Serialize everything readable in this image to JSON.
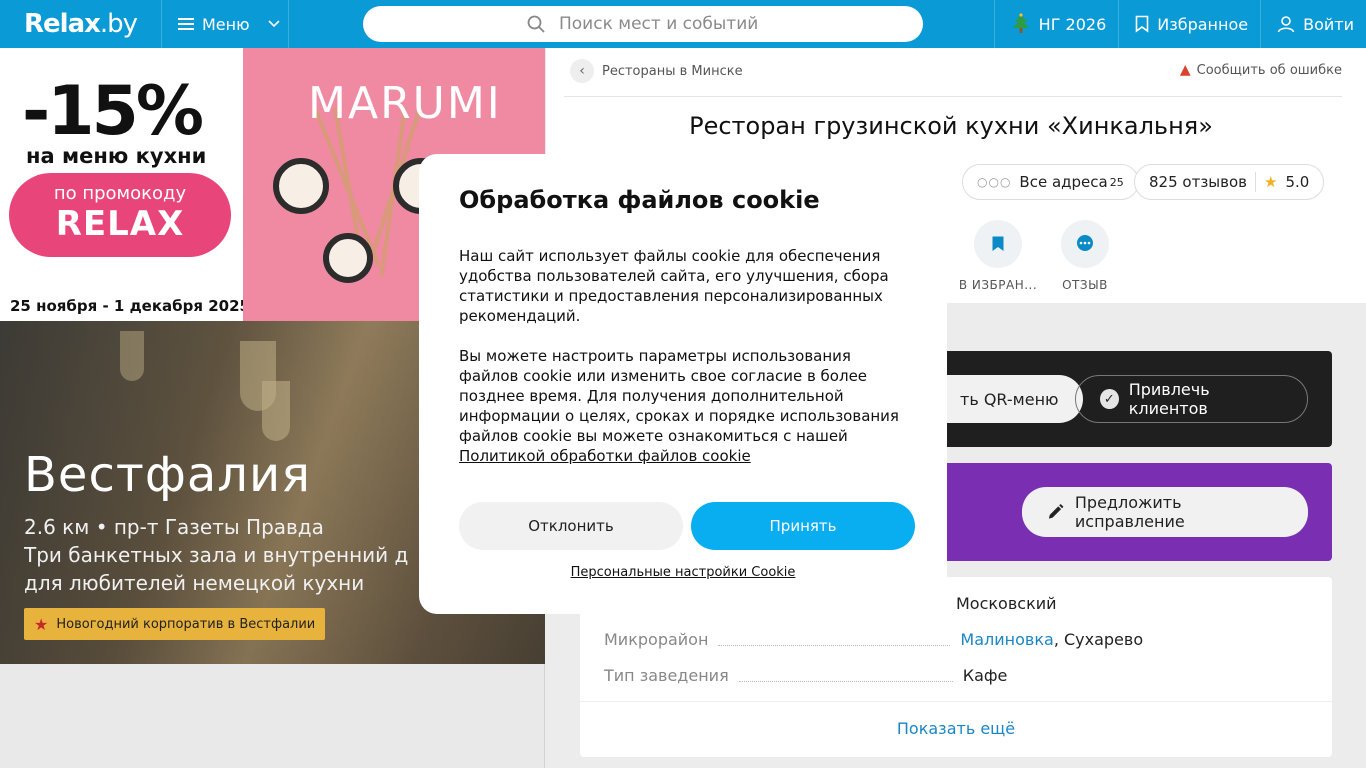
{
  "header": {
    "logo_main": "Relax",
    "logo_tld": ".by",
    "menu_label": "Меню",
    "search_placeholder": "Поиск мест и событий",
    "ng_label": "НГ 2026",
    "favorites_label": "Избранное",
    "login_label": "Войти"
  },
  "ad_banner": {
    "discount": "-15%",
    "on_menu": "на меню кухни",
    "promo_line": "по промокоду",
    "promo_code": "RELAX",
    "dates": "25 ноября - 1 декабря 2025",
    "brand": "MARUMI"
  },
  "venue_banner": {
    "title": "Вестфалия",
    "line1": "2.6 км • пр-т Газеты Правда",
    "line2": "Три банкетных зала и внутренний д",
    "line3": "для любителей немецкой кухни",
    "badge": "Новогодний корпоратив в Вестфалии"
  },
  "page": {
    "breadcrumb": "Рестораны в Минске",
    "report": "Сообщить об ошибке",
    "title": "Ресторан грузинской кухни «Хинкальня»",
    "chip_addresses": "Все адреса",
    "chip_addresses_count": "25",
    "chip_reviews": "825 отзывов",
    "chip_rating": "5.0",
    "action_favorite": "В ИЗБРАН...",
    "action_review": "ОТЗЫВ",
    "qr_menu": "ть QR-меню",
    "attract_clients": "Привлечь клиентов",
    "suggest_fix": "Предложить исправление"
  },
  "info": {
    "district_value": "Московский",
    "microdistrict_key": "Микрорайон",
    "microdistrict_link": "Малиновка",
    "microdistrict_rest": ", Сухарево",
    "type_key": "Тип заведения",
    "type_value": "Кафе",
    "show_more": "Показать ещё"
  },
  "cookie_modal": {
    "title": "Обработка файлов cookie",
    "p1": "Наш сайт использует файлы cookie для обеспечения удобства пользователей сайта, его улучшения, сбора статистики и предоставления персонализированных рекомендаций.",
    "p2": "Вы можете настроить параметры использования файлов cookie или изменить свое согласие в более позднее время. Для получения дополнительной информации о целях, сроках и порядке использования файлов cookie вы можете ознакомиться с нашей",
    "policy_link": "Политикой обработки файлов cookie",
    "decline": "Отклонить",
    "accept": "Принять",
    "custom_settings": "Персональные настройки Cookie"
  },
  "colors": {
    "header_blue": "#0a9ad6",
    "accept_blue": "#08aef0",
    "promo_pink": "#e8457a",
    "purple": "#7a2fb3",
    "link": "#1a86c4"
  }
}
